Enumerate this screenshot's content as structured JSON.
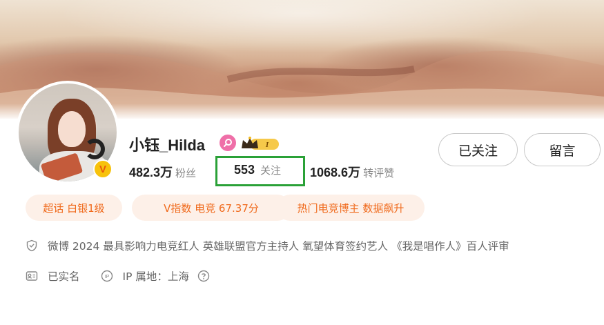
{
  "profile": {
    "username": "小钰_Hilda",
    "level_badge": "I",
    "verified_badge": "V",
    "stats": {
      "fans_count": "482.3万",
      "fans_label": "粉丝",
      "following_count": "553",
      "following_label": "关注",
      "reposts_count": "1068.6万",
      "reposts_label": "转评赞"
    }
  },
  "actions": {
    "follow_label": "已关注",
    "message_label": "留言"
  },
  "tags": [
    {
      "label": "超话 白银1级"
    },
    {
      "label": "V指数 电竞 67.37分"
    },
    {
      "label": "热门电竞博主 数据飙升"
    }
  ],
  "info": {
    "verification": "微博 2024 最具影响力电竞红人 英雄联盟官方主持人 氧望体育签约艺人 《我是唱作人》百人评审",
    "real_name": "已实名",
    "ip_location": "IP 属地：上海"
  },
  "colors": {
    "tag_text": "#f06a1c",
    "tag_background": "#fdf0e8",
    "highlight_box": "#2aa137",
    "verified_badge": "#f7c20c"
  },
  "icons": [
    "shield-check-icon",
    "id-card-icon",
    "ip-icon",
    "help-circle-icon",
    "pink-badge-icon",
    "crown-icon"
  ]
}
